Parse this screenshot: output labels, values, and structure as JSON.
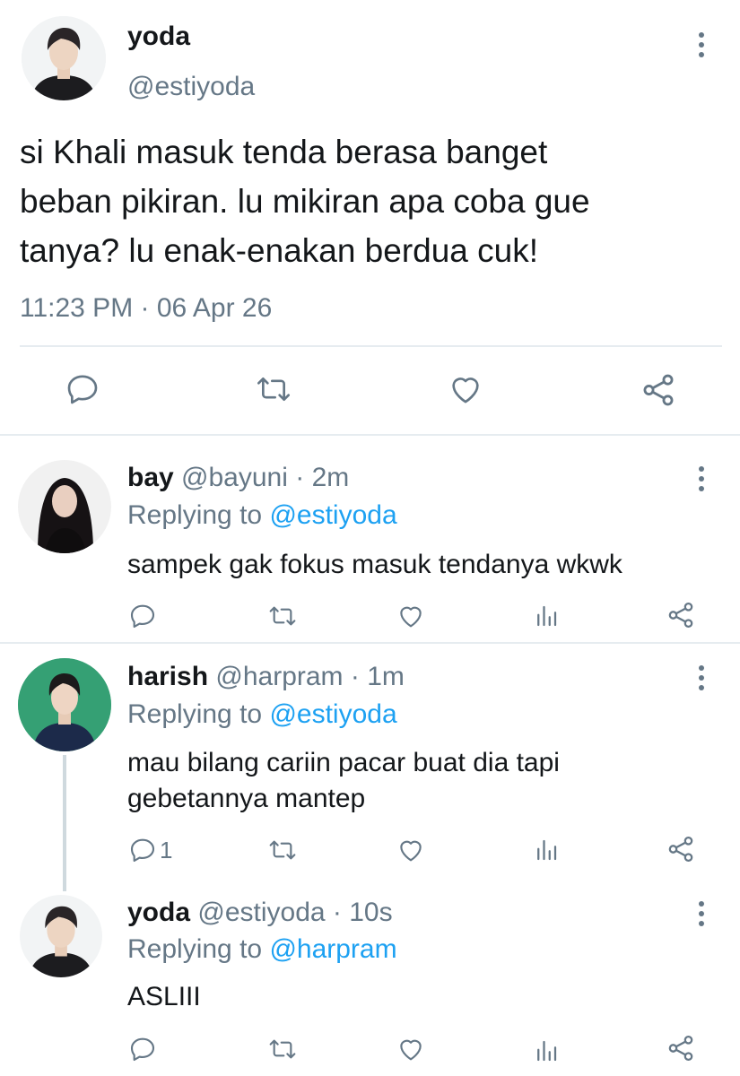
{
  "main_tweet": {
    "display_name": "yoda",
    "handle": "@estiyoda",
    "text_lines": [
      "si Khali masuk tenda berasa banget",
      "beban pikiran. lu mikiran apa coba gue",
      "tanya? lu enak-enakan berdua cuk!"
    ],
    "timestamp": "11:23 PM · 06 Apr 26",
    "icons": [
      "reply-icon",
      "retweet-icon",
      "like-icon",
      "share-icon",
      "more-options-icon"
    ]
  },
  "replies": [
    {
      "display_name": "bay",
      "handle": "@bayuni",
      "time": "· 2m",
      "replying_prefix": "Replying to ",
      "replying_to": "@estiyoda",
      "text_lines": [
        "sampek gak fokus masuk tendanya wkwk"
      ],
      "reply_count": ""
    },
    {
      "display_name": "harish",
      "handle": "@harpram",
      "time": "· 1m",
      "replying_prefix": "Replying to ",
      "replying_to": "@estiyoda",
      "text_lines": [
        "mau bilang cariin pacar buat dia tapi",
        "gebetannya mantep"
      ],
      "reply_count": "1"
    },
    {
      "display_name": "yoda",
      "handle": "@estiyoda",
      "time": "· 10s",
      "replying_prefix": "Replying to ",
      "replying_to": "@harpram",
      "text_lines": [
        "ASLIII"
      ],
      "reply_count": ""
    }
  ],
  "colors": {
    "text": "#14171a",
    "secondary": "#657786",
    "link": "#1da1f2",
    "divider": "#e6ecf0"
  }
}
